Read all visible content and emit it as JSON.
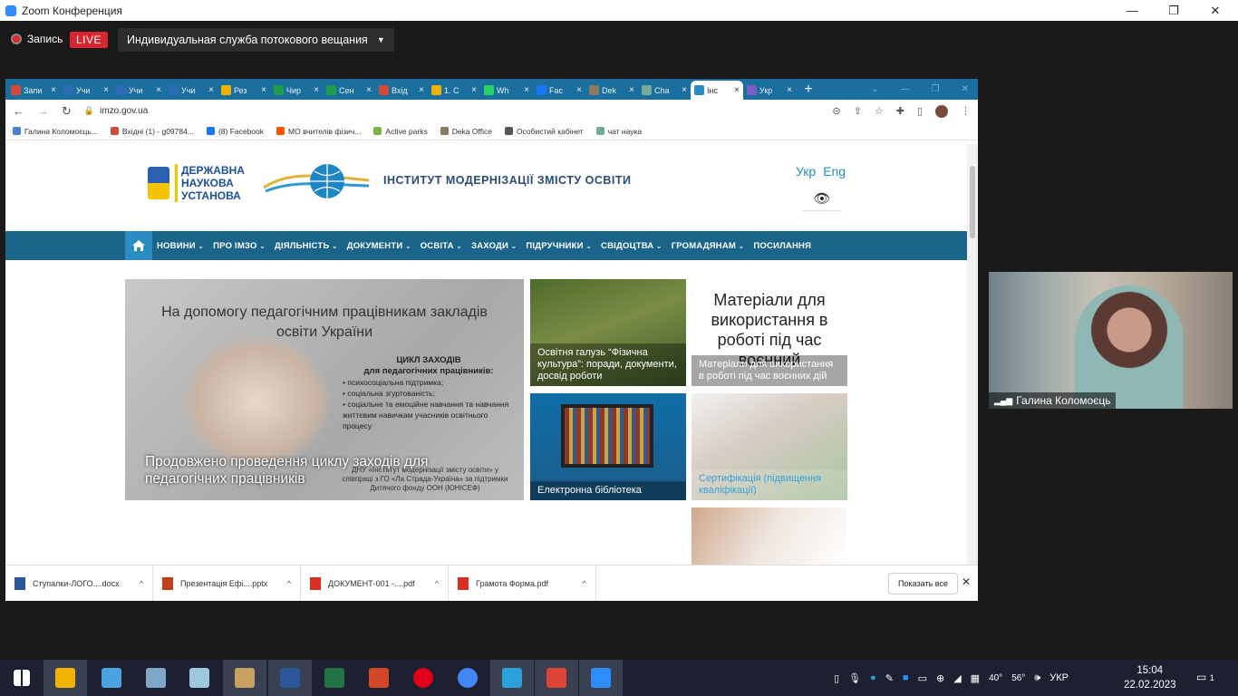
{
  "zoom": {
    "title": "Zoom Конференция",
    "controls": [
      "—",
      "❐",
      "✕"
    ],
    "record_label": "Запись",
    "live_label": "LIVE",
    "stream_label": "Индивидуальная служба потокового вещания",
    "stream_caret": "▼"
  },
  "browser": {
    "tabs": [
      {
        "label": "Запи",
        "icon_color": "#d44a3a",
        "icon": "mail-icon"
      },
      {
        "label": "Учи",
        "icon_color": "#2d6bb5",
        "icon": "z-icon"
      },
      {
        "label": "Учи",
        "icon_color": "#2d6bb5",
        "icon": "z-icon"
      },
      {
        "label": "Учи",
        "icon_color": "#2d6bb5",
        "icon": "z-icon"
      },
      {
        "label": "Рез",
        "icon_color": "#f0b400",
        "icon": "star-icon"
      },
      {
        "label": "Чир",
        "icon_color": "#1e9e4a",
        "icon": "plus-icon"
      },
      {
        "label": "Сен",
        "icon_color": "#1e9e4a",
        "icon": "plus-icon"
      },
      {
        "label": "Вхід",
        "icon_color": "#d44a3a",
        "icon": "mail-icon"
      },
      {
        "label": "1. С",
        "icon_color": "#f0b400",
        "icon": "drive-icon"
      },
      {
        "label": "Wh",
        "icon_color": "#25d366",
        "icon": "whatsapp-icon"
      },
      {
        "label": "Fac",
        "icon_color": "#1877f2",
        "icon": "facebook-icon"
      },
      {
        "label": "Dek",
        "icon_color": "#8a7a60",
        "icon": "deka-icon"
      },
      {
        "label": "Cha",
        "icon_color": "#74aa9c",
        "icon": "chat-icon"
      },
      {
        "label": "Інс",
        "icon_color": "#2b8cc4",
        "icon": "imzo-icon",
        "active": true
      },
      {
        "label": "Укр",
        "icon_color": "#7b5cc4",
        "icon": "doc-icon"
      }
    ],
    "tab_close": "×",
    "new_tab": "+",
    "url": "imzo.gov.ua",
    "bookmarks": [
      {
        "label": "Галина Коломоєць...",
        "color": "#4a7fd4"
      },
      {
        "label": "Вхідні (1) - g09784...",
        "color": "#d44a3a"
      },
      {
        "label": "(8) Facebook",
        "color": "#1877f2"
      },
      {
        "label": "МО вчителів фізич...",
        "color": "#ff5500"
      },
      {
        "label": "Active parks",
        "color": "#7cb342"
      },
      {
        "label": "Deka Office",
        "color": "#8a7a60"
      },
      {
        "label": "Особистий кабінет",
        "color": "#555555"
      },
      {
        "label": "чат наука",
        "color": "#74aa9c"
      }
    ]
  },
  "site": {
    "state_lines": [
      "ДЕРЖАВНА",
      "НАУКОВА",
      "УСТАНОВА"
    ],
    "institute": "ІНСТИТУТ МОДЕРНІЗАЦІЇ ЗМІСТУ ОСВІТИ",
    "lang": [
      "Укр",
      "Eng"
    ],
    "nav": [
      "НОВИНИ",
      "ПРО ІМЗО",
      "ДІЯЛЬНІСТЬ",
      "ДОКУМЕНТИ",
      "ОСВІТА",
      "ЗАХОДИ",
      "ПІДРУЧНИКИ",
      "СВІДОЦТВА",
      "ГРОМАДЯНАМ",
      "ПОСИЛАННЯ"
    ],
    "hero": {
      "heading": "На допомогу педагогічним працівникам закладів освіти України",
      "list_title": "ЦИКЛ ЗАХОДІВ",
      "list_sub": "для педагогічних працівників:",
      "list": [
        "психосоціальна підтримка;",
        "соціальна згуртованість;",
        "соціальне та емоційне навчання та навчання життєвим навичкам учасників освітнього процесу"
      ],
      "footnote": "ДНУ «Інститут модернізації змісту освіти» у співпраці з ГО «Ла Страда-Україна» за підтримки Дитячого фонду ООН (ЮНІСЕФ)",
      "caption": "Продовжено проведення циклу заходів для педагогічних працівників"
    },
    "tiles": {
      "sport": "Освітня галузь “Фізична культура”: поради, документи, досвід роботи",
      "materials_big": "Матеріали для використання в роботі під час воєнний",
      "materials_cap": "Матеріали для використання в роботі під час воєнних дій",
      "library": "Електронна бібліотека",
      "qualification": "Сертифікація (підвищення кваліфікації)"
    }
  },
  "downloads": {
    "items": [
      {
        "name": "Ступалки-ЛОГО....docx",
        "color": "#2b579a"
      },
      {
        "name": "Презентація Ефі....pptx",
        "color": "#c43e1c"
      },
      {
        "name": "ДОКУМЕНТ-001 -....pdf",
        "color": "#d93025"
      },
      {
        "name": "Грамота Форма.pdf",
        "color": "#d93025"
      }
    ],
    "show_all": "Показать все",
    "caret": "^",
    "close": "✕"
  },
  "video": {
    "name": "Галина Коломоєць"
  },
  "taskbar": {
    "apps": [
      {
        "name": "windows-start-icon",
        "color": "#ffffff"
      },
      {
        "name": "file-explorer-icon",
        "color": "#f0b400",
        "on": true
      },
      {
        "name": "control-panel-icon",
        "color": "#4aa3df"
      },
      {
        "name": "calculator-icon",
        "color": "#7fa7c9"
      },
      {
        "name": "notepad-icon",
        "color": "#9ec7e0"
      },
      {
        "name": "paint-icon",
        "color": "#c8a060",
        "on": true
      },
      {
        "name": "word-icon",
        "color": "#2b579a",
        "on": true
      },
      {
        "name": "excel-icon",
        "color": "#217346"
      },
      {
        "name": "powerpoint-icon",
        "color": "#d24726"
      },
      {
        "name": "opera-icon",
        "color": "#e0001a"
      },
      {
        "name": "chrome-icon",
        "color": "#4285f4"
      },
      {
        "name": "telegram-icon",
        "color": "#2aa1da",
        "on": true
      },
      {
        "name": "chrome-profile-icon",
        "color": "#db4437",
        "on": true
      },
      {
        "name": "zoom-icon",
        "color": "#2d8cff",
        "on": true
      }
    ],
    "lang": "УКР",
    "temp1": "40°",
    "temp2": "56°",
    "time": "15:04",
    "date": "22.02.2023",
    "notif_count": "1"
  }
}
